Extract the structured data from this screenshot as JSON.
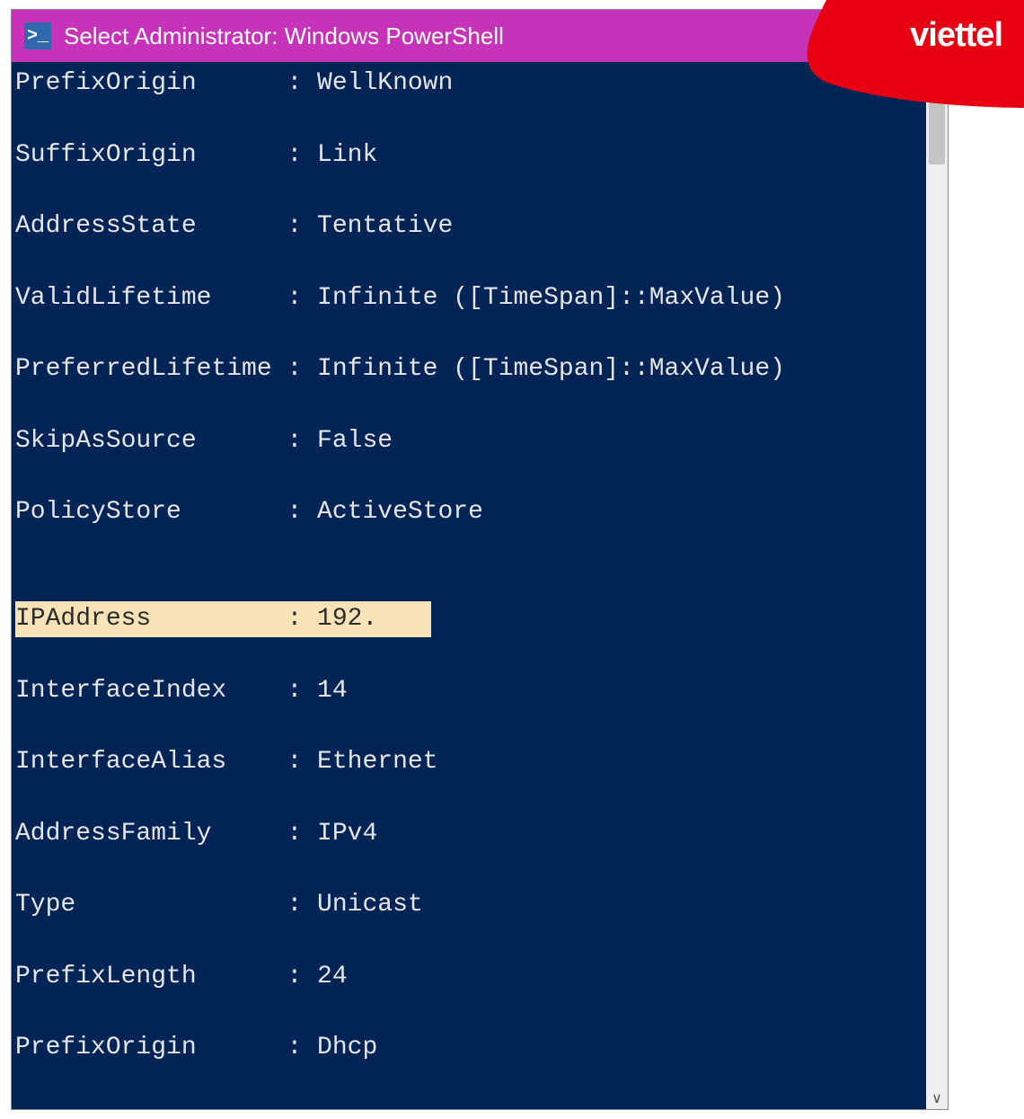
{
  "titlebar": {
    "icon_glyph": ">_",
    "title": "Select Administrator: Windows PowerShell"
  },
  "terminal": {
    "block1": [
      {
        "key": "PrefixOrigin",
        "value": "WellKnown"
      },
      {
        "key": "SuffixOrigin",
        "value": "Link"
      },
      {
        "key": "AddressState",
        "value": "Tentative"
      },
      {
        "key": "ValidLifetime",
        "value": "Infinite ([TimeSpan]::MaxValue)"
      },
      {
        "key": "PreferredLifetime",
        "value": "Infinite ([TimeSpan]::MaxValue)"
      },
      {
        "key": "SkipAsSource",
        "value": "False"
      },
      {
        "key": "PolicyStore",
        "value": "ActiveStore"
      }
    ],
    "highlight": {
      "key": "IPAddress",
      "value": "192."
    },
    "block2": [
      {
        "key": "InterfaceIndex",
        "value": "14"
      },
      {
        "key": "InterfaceAlias",
        "value": "Ethernet"
      },
      {
        "key": "AddressFamily",
        "value": "IPv4"
      },
      {
        "key": "Type",
        "value": "Unicast"
      },
      {
        "key": "PrefixLength",
        "value": "24"
      },
      {
        "key": "PrefixOrigin",
        "value": "Dhcp"
      }
    ],
    "key_width_chars": 18
  },
  "brand": {
    "name": "viettel",
    "color": "#e60012"
  }
}
